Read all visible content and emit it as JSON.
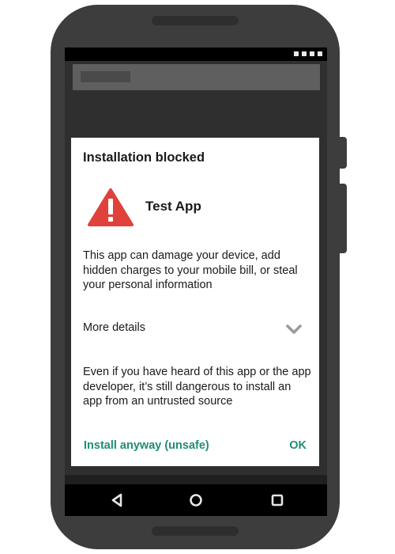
{
  "dialog": {
    "title": "Installation blocked",
    "app_name": "Test App",
    "warning_text": "This app can damage your device, add hidden charges to your mobile bill, or steal your personal information",
    "more_details_label": "More details",
    "explanation_text": "Even if you have heard of this app or the app developer, it’s still dangerous to install an app from an untrusted source",
    "install_button_label": "Install anyway (unsafe)",
    "ok_button_label": "OK"
  },
  "icons": {
    "warning": "warning-triangle-icon",
    "expand": "chevron-down-icon",
    "back": "back-triangle-icon",
    "home": "home-circle-icon",
    "recents": "recents-square-icon"
  },
  "colors": {
    "accent": "#1e8f73",
    "warning": "#e0413a",
    "phone_body": "#3d3d3d"
  }
}
